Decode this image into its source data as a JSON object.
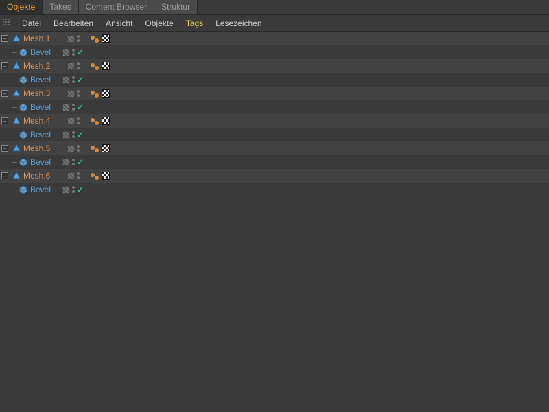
{
  "tabs": [
    {
      "label": "Objekte",
      "active": true
    },
    {
      "label": "Takes",
      "active": false
    },
    {
      "label": "Content Browser",
      "active": false
    },
    {
      "label": "Struktur",
      "active": false
    }
  ],
  "menu": {
    "items": [
      "Datei",
      "Bearbeiten",
      "Ansicht",
      "Objekte",
      "Tags",
      "Lesezeichen"
    ],
    "highlighted": "Tags"
  },
  "tree": [
    {
      "name": "Mesh.1",
      "child": "Bevel"
    },
    {
      "name": "Mesh.2",
      "child": "Bevel"
    },
    {
      "name": "Mesh.3",
      "child": "Bevel"
    },
    {
      "name": "Mesh.4",
      "child": "Bevel"
    },
    {
      "name": "Mesh.5",
      "child": "Bevel"
    },
    {
      "name": "Mesh.6",
      "child": "Bevel"
    }
  ],
  "icons": {
    "expander_open": "–",
    "checkmark": "✓"
  }
}
